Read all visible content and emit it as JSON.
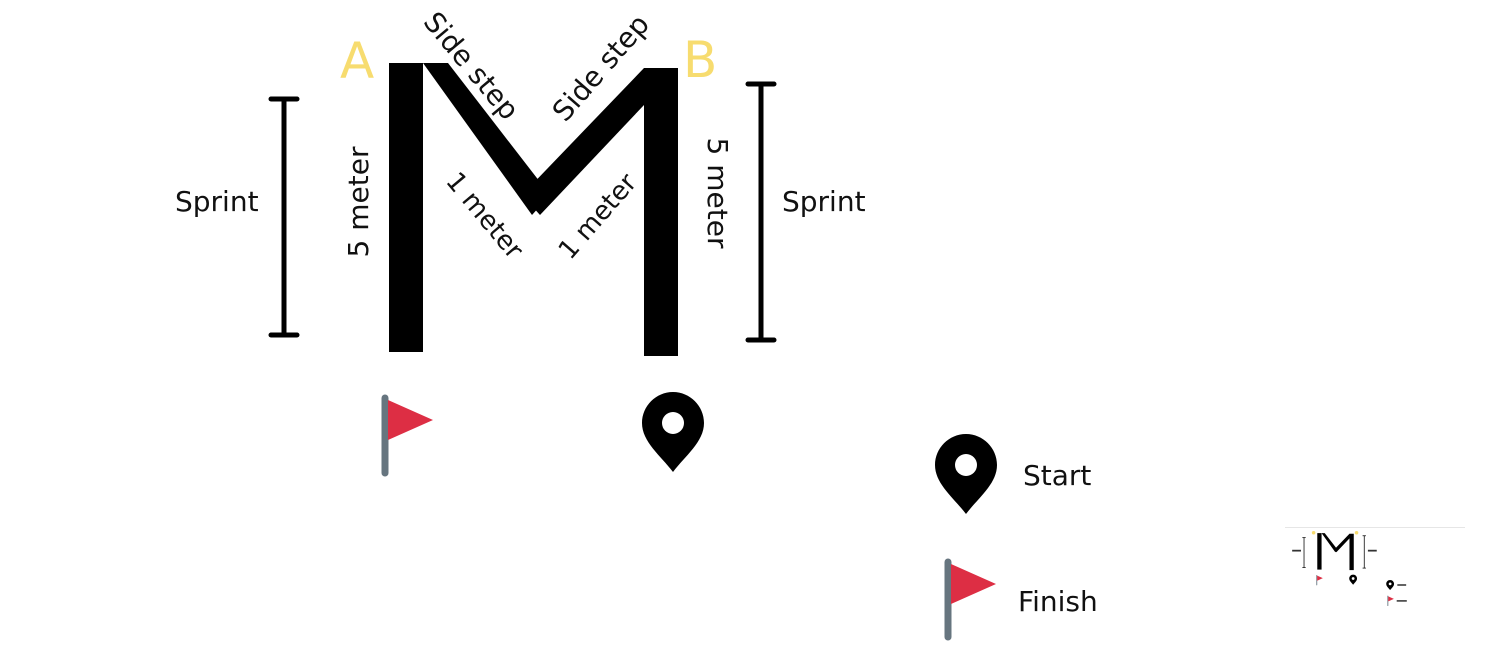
{
  "diagram": {
    "points": {
      "a": "A",
      "b": "B"
    },
    "labels": {
      "sprint_left": "Sprint",
      "sprint_right": "Sprint",
      "distance_left": "5 meter",
      "distance_right": "5 meter",
      "side_step_left": "Side step",
      "side_step_right": "Side step",
      "inner_left": "1 meter",
      "inner_right": "1 meter"
    },
    "legend": {
      "start": "Start",
      "finish": "Finish"
    },
    "icons": {
      "start": "map-pin-icon",
      "finish": "flag-icon"
    },
    "colors": {
      "point_label": "#f7dc6f",
      "flag": "#dd2e44",
      "flag_pole": "#66757f",
      "ink": "#000000"
    }
  }
}
